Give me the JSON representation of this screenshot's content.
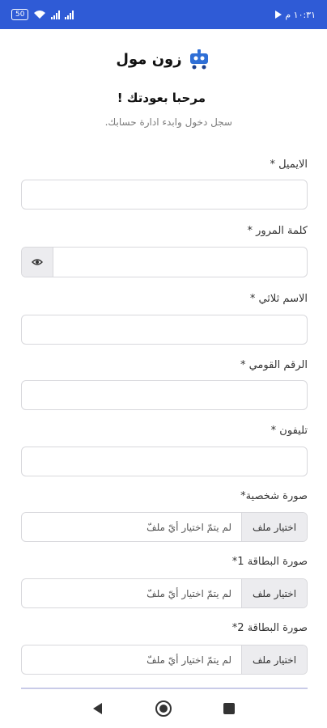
{
  "status_bar": {
    "battery": "50",
    "time": "١٠:٣١ م"
  },
  "brand": {
    "name": "زون مول",
    "logo_icon": "robot-cart-logo"
  },
  "header": {
    "welcome": "مرحبا بعودتك !",
    "subtitle": "سجل دخول وابدء ادارة حسابك."
  },
  "form": {
    "email_label": "الايميل *",
    "password_label": "كلمة المرور *",
    "fullname_label": "الاسم ثلاثي *",
    "national_id_label": "الرقم القومي *",
    "phone_label": "تليفون *",
    "profile_photo_label": "صورة شخصية*",
    "card1_label": "صورة البطاقة 1*",
    "card2_label": "صورة البطاقة 2*",
    "file_button": "اختيار ملف",
    "file_status": "لم يتمّ اختيار أيّ ملفّ"
  },
  "colors": {
    "status_bar": "#2f5bd6",
    "field_border": "#d8d8dc",
    "button_bg": "#ececef"
  }
}
